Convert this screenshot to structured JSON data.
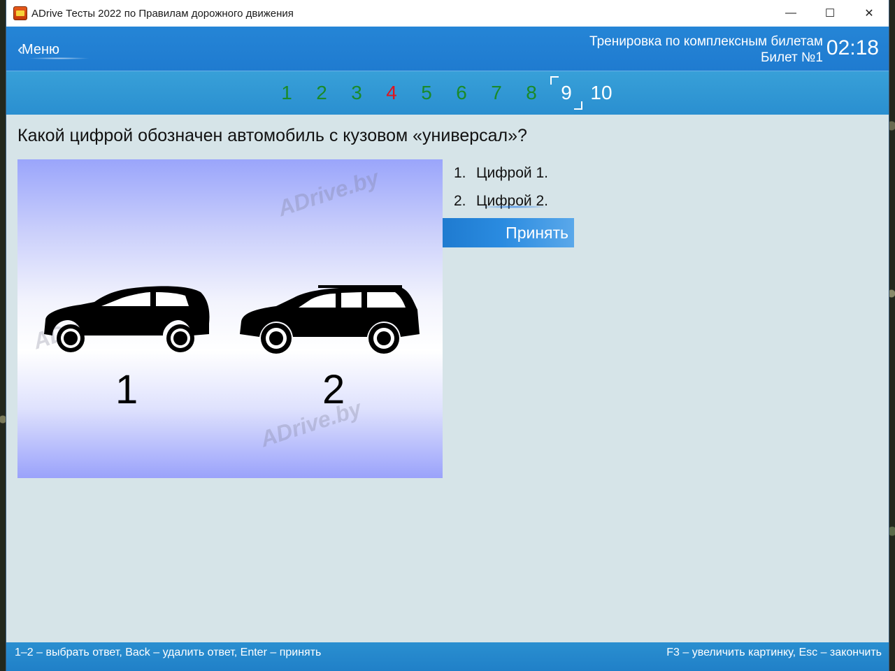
{
  "window": {
    "title": "ADrive Тесты 2022 по Правилам дорожного движения",
    "controls": {
      "minimize": "—",
      "maximize": "☐",
      "close": "✕"
    }
  },
  "header": {
    "menu_label": "Меню",
    "mode": "Тренировка по комплексным билетам",
    "ticket": "Билет №1",
    "timer": "02:18"
  },
  "tabs": [
    {
      "label": "1",
      "state": "correct"
    },
    {
      "label": "2",
      "state": "correct"
    },
    {
      "label": "3",
      "state": "correct"
    },
    {
      "label": "4",
      "state": "wrong"
    },
    {
      "label": "5",
      "state": "correct"
    },
    {
      "label": "6",
      "state": "correct"
    },
    {
      "label": "7",
      "state": "correct"
    },
    {
      "label": "8",
      "state": "correct"
    },
    {
      "label": "9",
      "state": "current"
    },
    {
      "label": "10",
      "state": "unanswered"
    }
  ],
  "question": {
    "text": "Какой цифрой обозначен автомобиль с кузовом «универсал»?",
    "picture": {
      "watermark": "ADrive.by",
      "car_labels": [
        "1",
        "2"
      ]
    },
    "answers": [
      {
        "num": "1.",
        "text": "Цифрой 1."
      },
      {
        "num": "2.",
        "text": "Цифрой 2."
      }
    ],
    "accept_label": "Принять"
  },
  "footer": {
    "left": "1–2 – выбрать ответ, Back – удалить ответ, Enter – принять",
    "right": "F3 – увеличить картинку, Esc – закончить"
  },
  "colors": {
    "header_blue": "#1f7bd0",
    "correct_green": "#1a8a2a",
    "wrong_red": "#e0141e",
    "content_bg": "#d6e4e8"
  }
}
